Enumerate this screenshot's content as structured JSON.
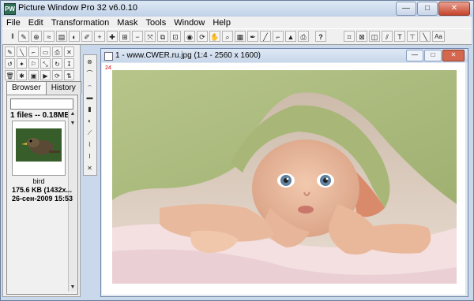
{
  "app": {
    "title": "Picture Window Pro 32  v6.0.10",
    "icon_label": "PW"
  },
  "window_controls": {
    "minimize": "—",
    "maximize": "□",
    "close": "✕"
  },
  "menu": [
    "File",
    "Edit",
    "Transformation",
    "Mask",
    "Tools",
    "Window",
    "Help"
  ],
  "toolbar": {
    "help_label": "?",
    "aa_label": "Aa"
  },
  "left_panel": {
    "tabs": [
      "Browser",
      "History"
    ],
    "files_summary": "1 files -- 0.18MB",
    "thumbnail": {
      "name": "bird",
      "size_info": "175.6 KB (1432x...",
      "date": "26-сен-2009 15:53"
    }
  },
  "document": {
    "title": "1 - www.CWER.ru.jpg (1:4 - 2560 x 1600)",
    "ruler_value": "24"
  },
  "colors": {
    "titlebar": "#c9d8ea",
    "close_button": "#c7442a"
  }
}
